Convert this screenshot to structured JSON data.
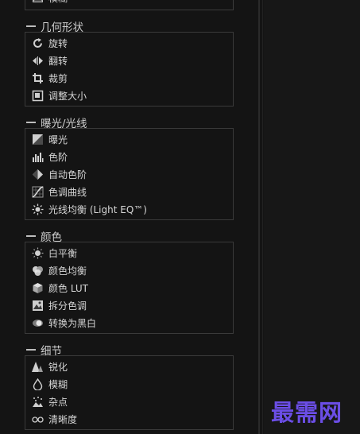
{
  "top": {
    "label": "模糊"
  },
  "sections": [
    {
      "title": "几何形状",
      "items": [
        "旋转",
        "翻转",
        "裁剪",
        "调整大小"
      ]
    },
    {
      "title": "曝光/光线",
      "items": [
        "曝光",
        "色阶",
        "自动色阶",
        "色调曲线",
        "光线均衡 (Light EQ™)"
      ]
    },
    {
      "title": "颜色",
      "items": [
        "白平衡",
        "颜色均衡",
        "颜色 LUT",
        "拆分色调",
        "转换为黑白"
      ]
    },
    {
      "title": "细节",
      "items": [
        "锐化",
        "模糊",
        "杂点",
        "清晰度"
      ]
    }
  ],
  "watermark": "最需网"
}
